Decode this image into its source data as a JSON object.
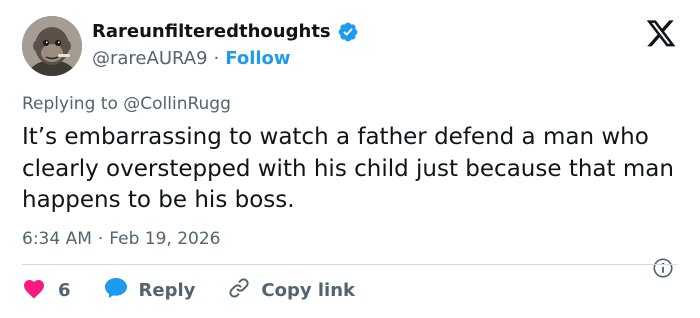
{
  "author": {
    "display_name": "Rareunfilteredthoughts",
    "handle": "@rareAURA9",
    "follow_label": "Follow",
    "verified": true,
    "avatar": "ape-avatar"
  },
  "reply_context": {
    "prefix": "Replying to",
    "mention": "@CollinRugg"
  },
  "tweet": {
    "text": "It’s embarrassing to watch a father defend a man who clearly overstepped with his child just because that man happens to be his boss.",
    "time": "6:34 AM",
    "date": "Feb 19, 2026"
  },
  "actions": {
    "like_count": "6",
    "reply_label": "Reply",
    "copy_label": "Copy link"
  },
  "icons": {
    "brand": "x-logo-icon",
    "verified": "verified-badge-icon",
    "info": "info-icon",
    "like": "heart-icon",
    "reply": "speech-bubble-icon",
    "copy": "link-icon"
  },
  "colors": {
    "accent": "#1d9bf0",
    "like": "#f91880",
    "text": "#0f1419",
    "muted": "#536471"
  }
}
